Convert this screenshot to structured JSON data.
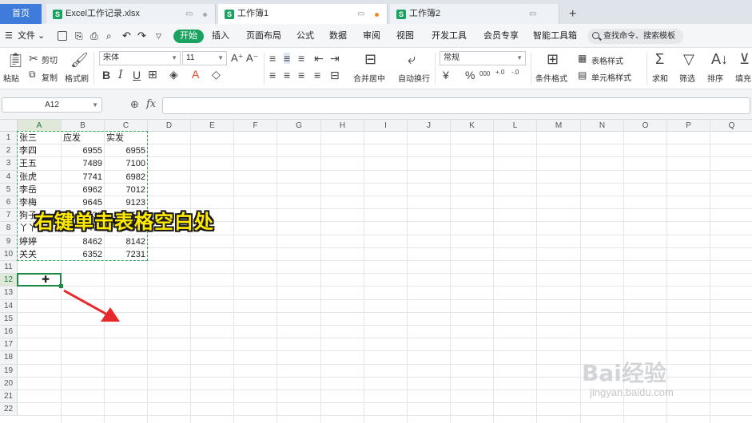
{
  "tabs": {
    "home": "首页",
    "docs": [
      {
        "title": "Excel工作记录.xlsx",
        "active": false
      },
      {
        "title": "工作簿1",
        "active": true
      },
      {
        "title": "工作簿2",
        "active": false
      }
    ],
    "new_tab": "+"
  },
  "menu": {
    "file": "文件",
    "items": [
      "开始",
      "插入",
      "页面布局",
      "公式",
      "数据",
      "审阅",
      "视图",
      "开发工具",
      "会员专享",
      "智能工具箱"
    ],
    "search": "查找命令、搜索模板"
  },
  "toolbar": {
    "paste": "粘贴",
    "cut": "剪切",
    "copy": "复制",
    "format_painter": "格式刷",
    "font_name": "宋体",
    "font_size": "11",
    "merge_center": "合并居中",
    "wrap_text": "自动换行",
    "number_format": "常规",
    "conditional_format": "条件格式",
    "table_style": "表格样式",
    "cell_style": "单元格样式",
    "sum": "求和",
    "filter": "筛选",
    "sort": "排序",
    "fill": "填充"
  },
  "formula_bar": {
    "name_box": "A12",
    "fx": "fx",
    "content": ""
  },
  "grid": {
    "columns": [
      "A",
      "B",
      "C",
      "D",
      "E",
      "F",
      "G",
      "H",
      "I",
      "J",
      "K",
      "L",
      "M",
      "N",
      "O",
      "P",
      "Q"
    ],
    "rows": [
      "1",
      "2",
      "3",
      "4",
      "5",
      "6",
      "7",
      "8",
      "9",
      "10",
      "11",
      "12",
      "13",
      "14",
      "15",
      "16",
      "17",
      "18",
      "19",
      "20",
      "21",
      "22"
    ],
    "data": [
      [
        "张三",
        "应发",
        "实发"
      ],
      [
        "李四",
        "6955",
        "6955"
      ],
      [
        "王五",
        "7489",
        "7100"
      ],
      [
        "张虎",
        "7741",
        "6982"
      ],
      [
        "李岳",
        "6962",
        "7012"
      ],
      [
        "李梅",
        "9645",
        "9123"
      ],
      [
        "狗子",
        "6532",
        "6532"
      ],
      [
        "丫丫",
        "6471",
        "6471"
      ],
      [
        "婷婷",
        "8462",
        "8142"
      ],
      [
        "关关",
        "6352",
        "7231"
      ]
    ],
    "selected_cell": "A12"
  },
  "annotation": "右键单击表格空白处",
  "watermark": {
    "text": "Bai经验",
    "url": "jingyan.baidu.com"
  }
}
